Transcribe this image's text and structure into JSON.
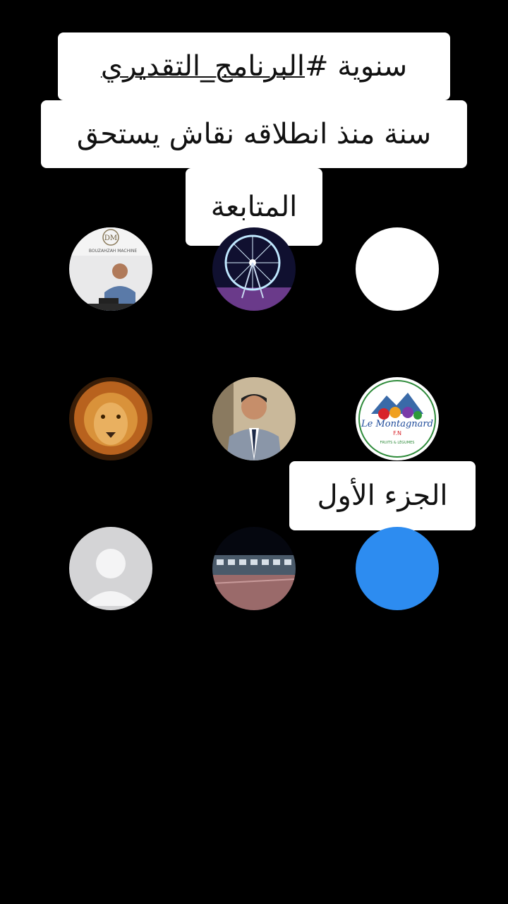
{
  "captions": {
    "line1_prefix": "سنوية #",
    "line1_tag": "البرنامج_التقديري",
    "line2": "سنة منذ انطلاقه نقاش يستحق",
    "line3": "المتابعة",
    "part_label": "الجزء الأول"
  },
  "avatars": {
    "a1_brand": "DM",
    "a1_text": "BOUZAHZAH MACHINE",
    "a6_brand": "Le Montagnard",
    "a6_sub": "F.N",
    "a6_small": "FRUITS & LÉGUMES"
  },
  "colors": {
    "background": "#000000",
    "caption_bg": "#ffffff",
    "blue_avatar": "#2d8cf0"
  }
}
